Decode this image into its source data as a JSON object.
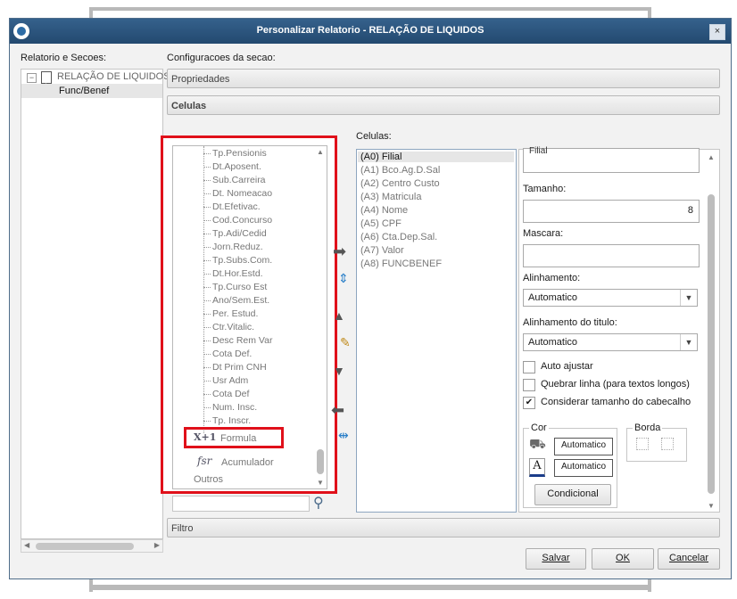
{
  "window": {
    "title": "Personalizar Relatorio - RELAÇÃO DE LIQUIDOS",
    "close_glyph": "×"
  },
  "left_panel": {
    "label": "Relatorio e Secoes:",
    "tree": {
      "root_label": "RELAÇÃO DE LIQUIDOS",
      "expander_glyph": "−",
      "child_label": "Func/Benef"
    }
  },
  "config": {
    "label": "Configuracoes da secao:",
    "propriedades": "Propriedades",
    "celulas": "Celulas"
  },
  "fields": {
    "items": [
      "Tp.Pensionis",
      "Dt.Aposent.",
      "Sub.Carreira",
      "Dt. Nomeacao",
      "Dt.Efetivac.",
      "Cod.Concurso",
      "Tp.Adi/Cedid",
      "Jorn.Reduz.",
      "Tp.Subs.Com.",
      "Dt.Hor.Estd.",
      "Tp.Curso Est",
      "Ano/Sem.Est.",
      "Per. Estud.",
      "Ctr.Vitalic.",
      "Desc Rem Var",
      "Cota Def.",
      "Dt Prim CNH",
      "Usr Adm",
      "Cota Def",
      "Num. Insc.",
      "Tp. Inscr."
    ],
    "formula_icon": "X+1",
    "formula_label": "Formula",
    "acumulador_icon": "fsr",
    "acumulador_label": "Acumulador",
    "outros_label": "Outros"
  },
  "cells": {
    "label": "Celulas:",
    "items": [
      "(A0) Filial",
      "(A1) Bco.Ag.D.Sal",
      "(A2) Centro Custo",
      "(A3) Matricula",
      "(A4) Nome",
      "(A5) CPF",
      "(A6) Cta.Dep.Sal.",
      "(A7) Valor",
      "(A8) FUNCBENEF"
    ],
    "selected_index": 0
  },
  "properties": {
    "top_value": "Filial",
    "tamanho_label": "Tamanho:",
    "tamanho_value": "8",
    "mascara_label": "Mascara:",
    "mascara_value": "",
    "alinhamento_label": "Alinhamento:",
    "alinhamento_value": "Automatico",
    "alinhamento_titulo_label": "Alinhamento do titulo:",
    "alinhamento_titulo_value": "Automatico",
    "checkboxes": [
      {
        "label": "Auto ajustar",
        "checked": false
      },
      {
        "label": "Quebrar linha (para textos longos)",
        "checked": false
      },
      {
        "label": "Considerar tamanho do cabecalho",
        "checked": true
      }
    ],
    "cor_label": "Cor",
    "cor_fill_value": "Automatico",
    "cor_font_value": "Automatico",
    "font_icon_letter": "A",
    "condicional_label": "Condicional",
    "borda_label": "Borda"
  },
  "filtro_label": "Filtro",
  "buttons": {
    "salvar": "Salvar",
    "ok": "OK",
    "cancelar": "Cancelar"
  },
  "colors": {
    "titlebar": "#2d5680",
    "highlight_red": "#e0101a",
    "selected_cell_bg": "#e6e6e6"
  }
}
